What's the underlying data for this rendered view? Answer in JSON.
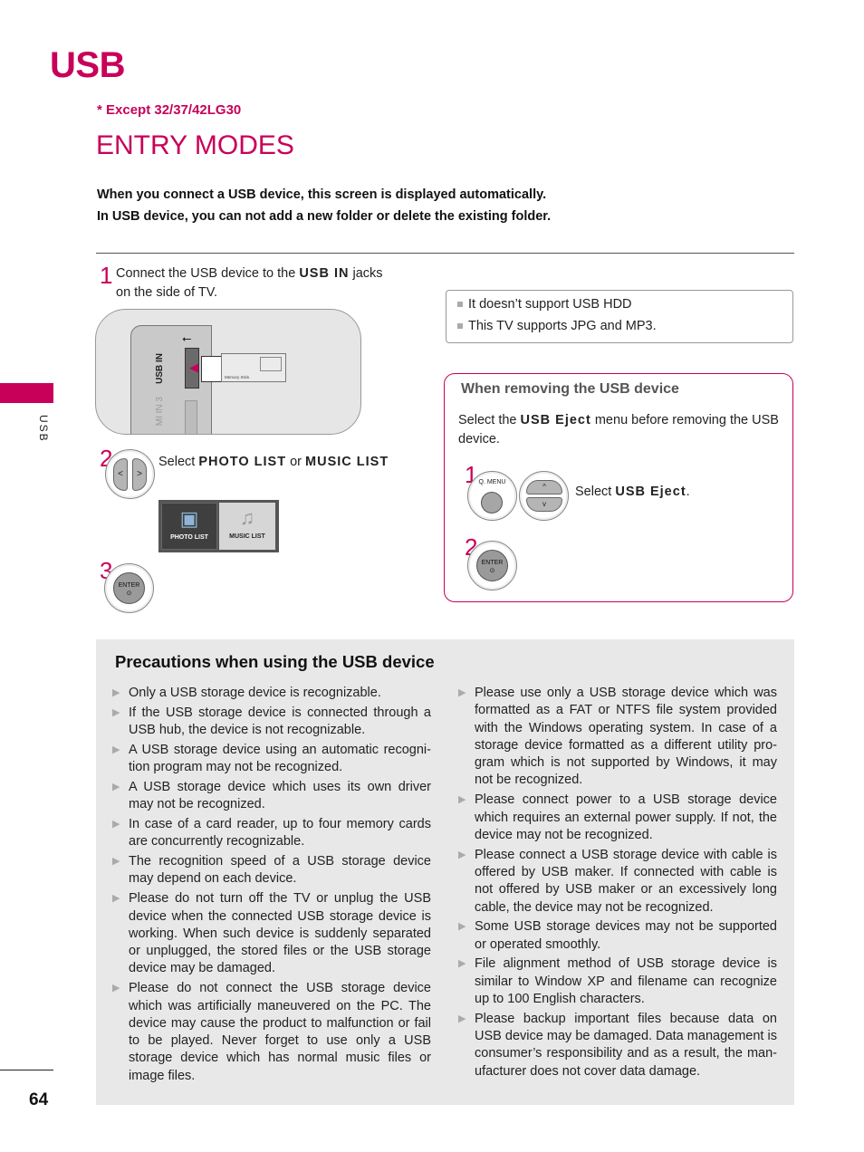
{
  "header": {
    "chapter_title": "USB",
    "model_note": "* Except 32/37/42LG30",
    "section_title": "ENTRY MODES",
    "intro_lines": [
      "When you connect a USB device, this screen is displayed automatically.",
      "In USB device, you can not add a new folder or delete the existing folder."
    ]
  },
  "side_tab": {
    "label": "USB",
    "accent_color": "#c8005a"
  },
  "steps": [
    {
      "number": "1",
      "text_before": "Connect the USB device to the ",
      "keyword": "USB IN",
      "text_after": " jacks on the side of TV."
    },
    {
      "number": "2",
      "text_before": "Select ",
      "keyword": "PHOTO LIST",
      "text_mid": " or ",
      "keyword2": "MUSIC LIST"
    },
    {
      "number": "3"
    }
  ],
  "illustration": {
    "port_label": "USB IN",
    "hdmi_label": "MI IN 3",
    "usb_symbol_icon": "usb-icon",
    "stick_label": "Memory Stick"
  },
  "list_menu": {
    "items": [
      {
        "label": "PHOTO LIST",
        "icon": "photo-icon"
      },
      {
        "label": "MUSIC LIST",
        "icon": "music-note-icon",
        "selected": true
      }
    ]
  },
  "remote_buttons": {
    "left": "<",
    "right": ">",
    "up": "^",
    "down": "v",
    "enter_label": "ENTER",
    "enter_symbol": "⊙",
    "qmenu_label": "Q. MENU"
  },
  "notes": [
    "It doesn’t support USB HDD",
    "This TV supports JPG and MP3."
  ],
  "removing": {
    "title": "When removing the USB device",
    "text_before": "Select the ",
    "keyword": "USB Eject",
    "text_after": " menu before removing the USB device.",
    "step1_number": "1",
    "step1_before": "Select ",
    "step1_keyword": "USB Eject",
    "step1_after": ".",
    "step2_number": "2"
  },
  "precautions": {
    "title": "Precautions when using the USB device",
    "left_items": [
      "Only a USB storage device is recognizable.",
      "If the USB storage device is connected through a USB hub, the device is not recognizable.",
      "A USB storage device using an automatic recogni-tion program may not be recognized.",
      "A USB storage device which uses its own driver may not be recognized.",
      "In case of a card reader, up to four memory cards are concurrently recognizable.",
      "The recognition speed of a USB storage device may depend on each device.",
      "Please do not turn off the TV or unplug the USB device when the connected USB storage device is working.  When such device is suddenly separated or unplugged, the stored files or the USB storage device may be damaged.",
      "Please do not connect the USB storage device which was artificially maneuvered on the PC.  The device may cause the product to malfunction or fail to be played.  Never forget to use only a USB storage device which has normal music files or image files."
    ],
    "right_items": [
      "Please use only a USB storage device which was formatted as a FAT or NTFS file system provided with the Windows operating system.  In case of a storage device formatted as a different utility pro-gram which is not supported by Windows, it may not be recognized.",
      "Please connect power to a USB storage device which requires an external power supply.  If not, the device may not be recognized.",
      "Please connect a USB storage device with cable is offered by USB maker.  If connected with cable is not offered by USB maker or an excessively long cable, the device may not be recognized.",
      "Some USB storage devices may not be supported or operated smoothly.",
      "File alignment method of USB storage device is similar to Window XP and filename can recognize up to 100 English characters.",
      "Please backup important files because data on USB device may be damaged. Data management is consumer’s responsibility and as a result, the man-ufacturer does not cover data damage."
    ],
    "bullet_icon": "▶"
  },
  "footer": {
    "page_number": "64"
  }
}
